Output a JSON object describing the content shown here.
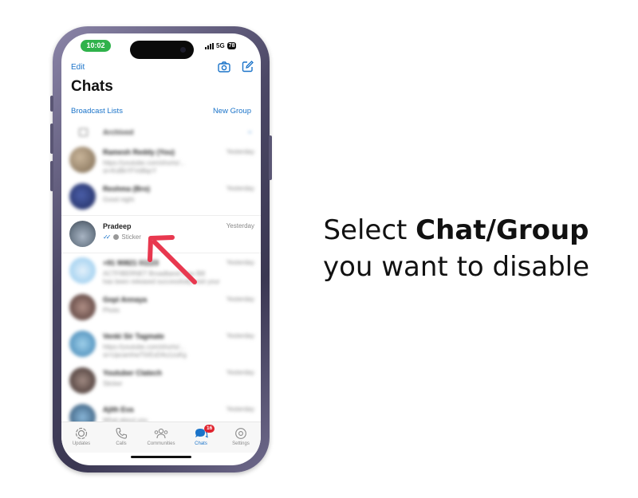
{
  "status": {
    "time": "10:02",
    "network": "5G",
    "battery": "78"
  },
  "header": {
    "edit_label": "Edit",
    "title": "Chats",
    "broadcast_label": "Broadcast Lists",
    "new_group_label": "New Group"
  },
  "archived": {
    "label": "Archived"
  },
  "chats": [
    {
      "name": "Ramesh Reddy (You)",
      "time": "Yesterday",
      "message": "https://youtube.com/shorts/...",
      "message2": "si=KxBkYFVd8qcY"
    },
    {
      "name": "Reshma (Bro)",
      "time": "Yesterday",
      "message": "Good night"
    },
    {
      "name": "Pradeep",
      "time": "Yesterday",
      "message": "Sticker"
    },
    {
      "name": "+91 90821 01123",
      "time": "Yesterday",
      "message": "ACTFIBERNET Broadband New Bill",
      "message2": "has been released successfully, visit your"
    },
    {
      "name": "Gopi Annaya",
      "time": "Yesterday",
      "message": "Photo"
    },
    {
      "name": "Venki Sir Tagmate",
      "time": "Yesterday",
      "message": "https://youtube.com/shorts/...",
      "message2": "si=UpcamhwT0rEsD4u1zuKg"
    },
    {
      "name": "Youtuber Clatech",
      "time": "Yesterday",
      "message": "Sticker"
    },
    {
      "name": "Ajith Eva",
      "time": "Yesterday",
      "message": "What about you"
    }
  ],
  "tabs": [
    {
      "label": "Updates",
      "icon": "updates-icon"
    },
    {
      "label": "Calls",
      "icon": "calls-icon"
    },
    {
      "label": "Communities",
      "icon": "communities-icon"
    },
    {
      "label": "Chats",
      "icon": "chats-icon",
      "badge": "16"
    },
    {
      "label": "Settings",
      "icon": "settings-icon"
    }
  ],
  "caption": {
    "line1_normal": "Select ",
    "line1_bold": "Chat/Group",
    "line2": "you want to disable"
  },
  "colors": {
    "accent": "#1a73c9",
    "status_green": "#2fb24b",
    "arrow_red": "#e8384f",
    "badge_red": "#e0232e"
  }
}
